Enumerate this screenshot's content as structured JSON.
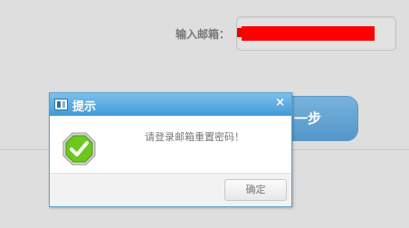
{
  "form": {
    "email_label": "输入邮箱：",
    "email_value": "redacted",
    "next_button_label": "一步"
  },
  "dialog": {
    "title": "提示",
    "close_glyph": "×",
    "message": "请登录邮箱重置密码！",
    "confirm_label": "确定",
    "icons": {
      "window": "window-icon",
      "success": "checkmark-success-icon",
      "close": "close-icon"
    }
  },
  "colors": {
    "titlebar_top": "#7cc0ec",
    "titlebar_bottom": "#3f9ad8",
    "next_button": "#5496c9",
    "redaction": "#ff0000",
    "success_green": "#6cc81c"
  }
}
